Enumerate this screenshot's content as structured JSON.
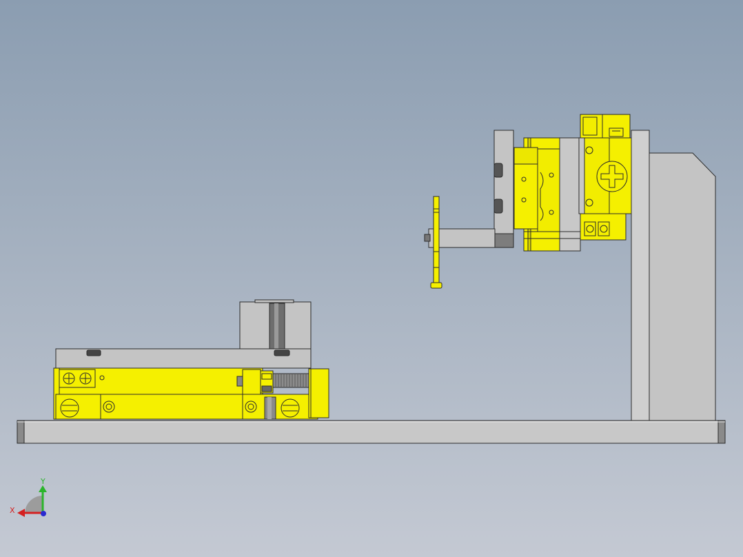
{
  "viewport": {
    "background_top": "#8b9db1",
    "background_bottom": "#c4c9d3"
  },
  "model": {
    "part_colors": {
      "steel": "#c4c4c4",
      "steel_dark": "#a8a8a8",
      "cylinder_yellow": "#f5f000",
      "edge": "#2a2a2a"
    }
  },
  "triad": {
    "y_label": "Y",
    "x_label": "X",
    "y_color": "#2bb52b",
    "x_color": "#d42020",
    "z_color": "#2a2ad0"
  }
}
